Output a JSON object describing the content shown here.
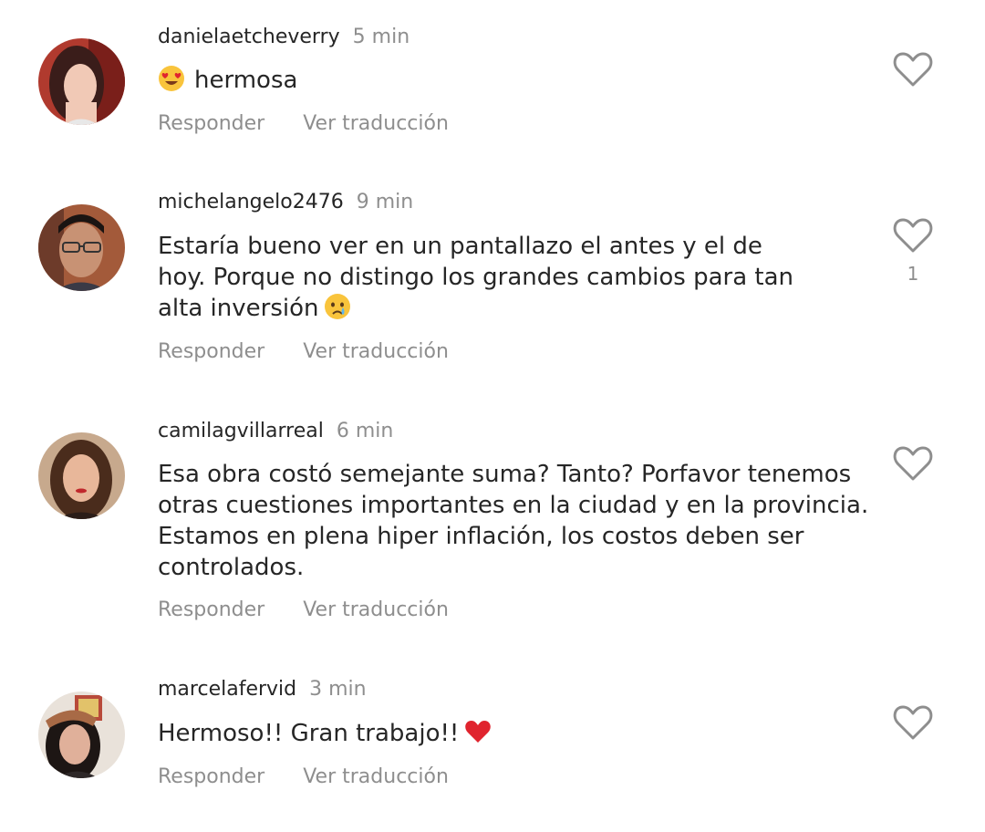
{
  "comments": [
    {
      "username": "danielaetcheverry",
      "time": "5 min",
      "text": "hermosa",
      "emoji": "heart-eyes-emoji",
      "reply_label": "Responder",
      "translate_label": "Ver traducción",
      "likes": ""
    },
    {
      "username": "michelangelo2476",
      "time": "9 min",
      "text": "Estaría bueno ver en un pantallazo el antes y el de hoy. Porque no distingo los grandes cambios para tan alta inversión",
      "emoji": "crying-face-emoji",
      "reply_label": "Responder",
      "translate_label": "Ver traducción",
      "likes": "1"
    },
    {
      "username": "camilagvillarreal",
      "time": "6 min",
      "text": "Esa obra costó semejante suma? Tanto? Porfavor tenemos otras cuestiones importantes en la ciudad y en la provincia. Estamos en plena hiper inflación, los costos deben ser controlados.",
      "reply_label": "Responder",
      "translate_label": "Ver traducción",
      "likes": ""
    },
    {
      "username": "marcelafervid",
      "time": "3 min",
      "text": "Hermoso!! Gran trabajo!!",
      "emoji": "red-heart-emoji",
      "reply_label": "Responder",
      "translate_label": "Ver traducción",
      "likes": ""
    }
  ],
  "colors": {
    "text": "#262626",
    "secondary": "#8e8e8e",
    "heart_outline": "#8e8e8e",
    "emoji_heart": "#e0242e"
  }
}
